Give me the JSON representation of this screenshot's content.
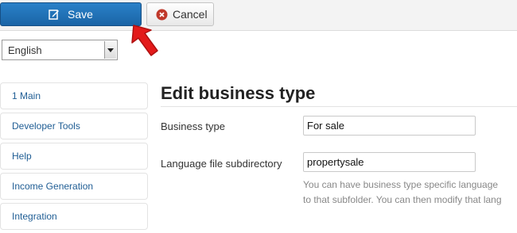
{
  "toolbar": {
    "save_label": "Save",
    "cancel_label": "Cancel",
    "save_icon": "edit-icon",
    "cancel_icon": "cancel-icon"
  },
  "language_select": {
    "selected": "English"
  },
  "sidebar": {
    "items": [
      {
        "label": "1 Main"
      },
      {
        "label": "Developer Tools"
      },
      {
        "label": "Help"
      },
      {
        "label": "Income Generation"
      },
      {
        "label": "Integration"
      }
    ]
  },
  "main": {
    "title": "Edit business type",
    "fields": {
      "business_type": {
        "label": "Business type",
        "value": "For sale"
      },
      "language_dir": {
        "label": "Language file subdirectory",
        "value": "propertysale"
      }
    },
    "help_line1": "You can have business type specific language",
    "help_line2": "to that subfolder. You can then modify that lang"
  },
  "colors": {
    "accent": "#1f6fb2",
    "link": "#1f5d94",
    "arrow": "#e31a1a"
  }
}
